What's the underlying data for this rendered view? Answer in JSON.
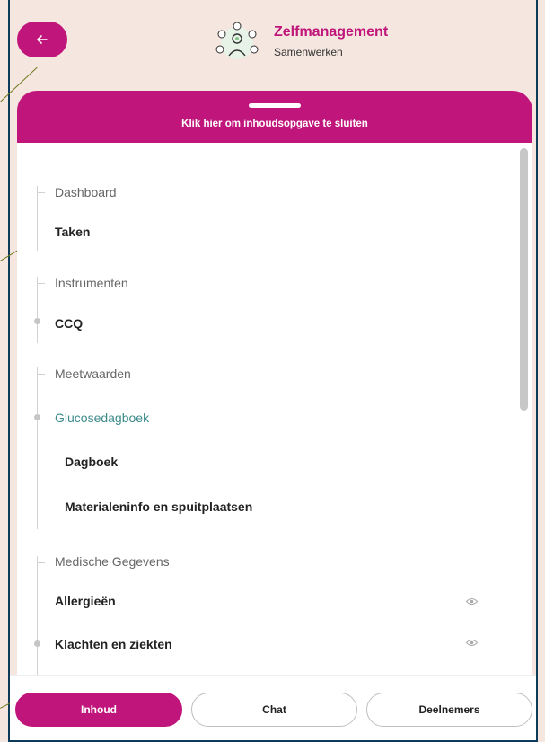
{
  "header": {
    "back_icon": "arrow-left-icon",
    "logo_icon": "collaboration-people-icon",
    "title": "Zelfmanagement",
    "subtitle": "Samenwerken"
  },
  "panel": {
    "close_label": "Klik hier om inhoudsopgave te sluiten",
    "sections": [
      {
        "category": "Dashboard",
        "items": [
          {
            "label": "Taken"
          }
        ]
      },
      {
        "category": "Instrumenten",
        "items": [
          {
            "label": "CCQ"
          }
        ]
      },
      {
        "category": "Meetwaarden",
        "items": [
          {
            "label": "Glucosedagboek"
          },
          {
            "label": "Dagboek"
          },
          {
            "label": "Materialeninfo en spuitplaatsen"
          }
        ]
      },
      {
        "category": "Medische Gegevens",
        "items": [
          {
            "label": "Allergieën",
            "icon": "eye-icon"
          },
          {
            "label": "Klachten en ziekten",
            "icon": "eye-icon"
          }
        ]
      }
    ]
  },
  "tabs": [
    {
      "label": "Inhoud",
      "active": true
    },
    {
      "label": "Chat",
      "active": false
    },
    {
      "label": "Deelnemers",
      "active": false
    }
  ],
  "colors": {
    "accent": "#c0157a",
    "background": "#f5e6df",
    "teal_text": "#3d8a8a"
  }
}
